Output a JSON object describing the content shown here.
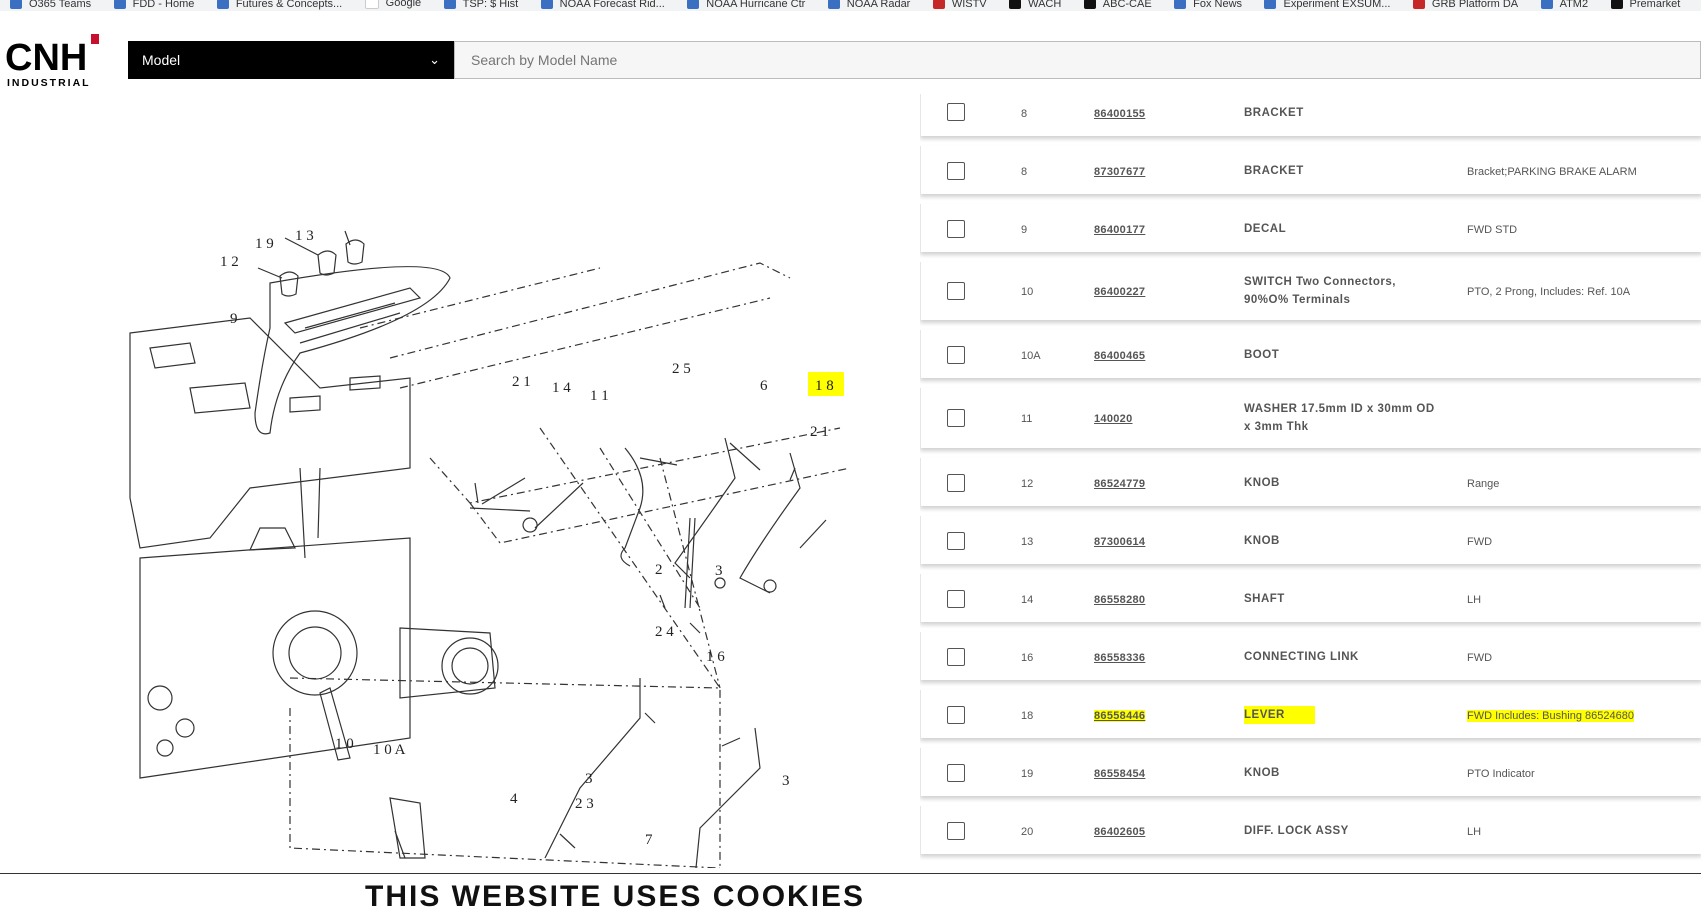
{
  "bookmarks": [
    {
      "label": "O365 Teams",
      "icon": "teams-icon"
    },
    {
      "label": "FDD - Home",
      "icon": "sharepoint-icon"
    },
    {
      "label": "Futures & Concepts...",
      "icon": "sharepoint-icon"
    },
    {
      "label": "Google",
      "icon": "google-icon"
    },
    {
      "label": "TSP: $ Hist",
      "icon": "tsp-icon"
    },
    {
      "label": "NOAA Forecast Rid...",
      "icon": "noaa-icon"
    },
    {
      "label": "NOAA Hurricane Ctr",
      "icon": "noaa-icon"
    },
    {
      "label": "NOAA Radar",
      "icon": "noaa-icon"
    },
    {
      "label": "WISTV",
      "icon": "wistv-icon"
    },
    {
      "label": "WACH",
      "icon": "wach-icon"
    },
    {
      "label": "ABC-CAE",
      "icon": "abc-icon"
    },
    {
      "label": "Fox News",
      "icon": "fox-icon"
    },
    {
      "label": "Experiment EXSUM...",
      "icon": "sharepoint-icon"
    },
    {
      "label": "GRB Platform DA",
      "icon": "grb-icon"
    },
    {
      "label": "ATM2",
      "icon": "teams-icon"
    },
    {
      "label": "Premarket",
      "icon": "premarket-icon"
    }
  ],
  "logo": {
    "main": "CNH",
    "sub": "INDUSTRIAL"
  },
  "model_select": {
    "label": "Model"
  },
  "search": {
    "placeholder": "Search by Model Name"
  },
  "diagram_labels": [
    "1 9",
    "1 3",
    "1 2",
    "9",
    "2 1",
    "1 4",
    "1 1",
    "2 5",
    "6",
    "1 8",
    "2 1",
    "2",
    "3",
    "2 4",
    "1 6",
    "1 0",
    "1 0 A",
    "4",
    "2 3",
    "3",
    "3",
    "7"
  ],
  "parts": [
    {
      "ref": "8",
      "part_number": "86400155",
      "description": "BRACKET",
      "remarks": ""
    },
    {
      "ref": "8",
      "part_number": "87307677",
      "description": "BRACKET",
      "remarks": "Bracket;PARKING BRAKE ALARM"
    },
    {
      "ref": "9",
      "part_number": "86400177",
      "description": "DECAL",
      "remarks": "FWD STD"
    },
    {
      "ref": "10",
      "part_number": "86400227",
      "description": "SWITCH Two Connectors, 90%O% Terminals",
      "remarks": "PTO, 2 Prong, Includes: Ref. 10A"
    },
    {
      "ref": "10A",
      "part_number": "86400465",
      "description": "BOOT",
      "remarks": ""
    },
    {
      "ref": "11",
      "part_number": "140020",
      "description": "WASHER 17.5mm ID x 30mm OD x 3mm Thk",
      "remarks": ""
    },
    {
      "ref": "12",
      "part_number": "86524779",
      "description": "KNOB",
      "remarks": "Range"
    },
    {
      "ref": "13",
      "part_number": "87300614",
      "description": "KNOB",
      "remarks": "FWD"
    },
    {
      "ref": "14",
      "part_number": "86558280",
      "description": "SHAFT",
      "remarks": "LH"
    },
    {
      "ref": "16",
      "part_number": "86558336",
      "description": "CONNECTING LINK",
      "remarks": "FWD"
    },
    {
      "ref": "18",
      "part_number": "86558446",
      "description": "LEVER",
      "remarks": "FWD Includes: Bushing 86524680"
    },
    {
      "ref": "19",
      "part_number": "86558454",
      "description": "KNOB",
      "remarks": "PTO Indicator"
    },
    {
      "ref": "20",
      "part_number": "86402605",
      "description": "DIFF. LOCK ASSY",
      "remarks": "LH"
    }
  ],
  "highlighted_ref": "18",
  "cookie_banner": "THIS WEBSITE USES COOKIES"
}
